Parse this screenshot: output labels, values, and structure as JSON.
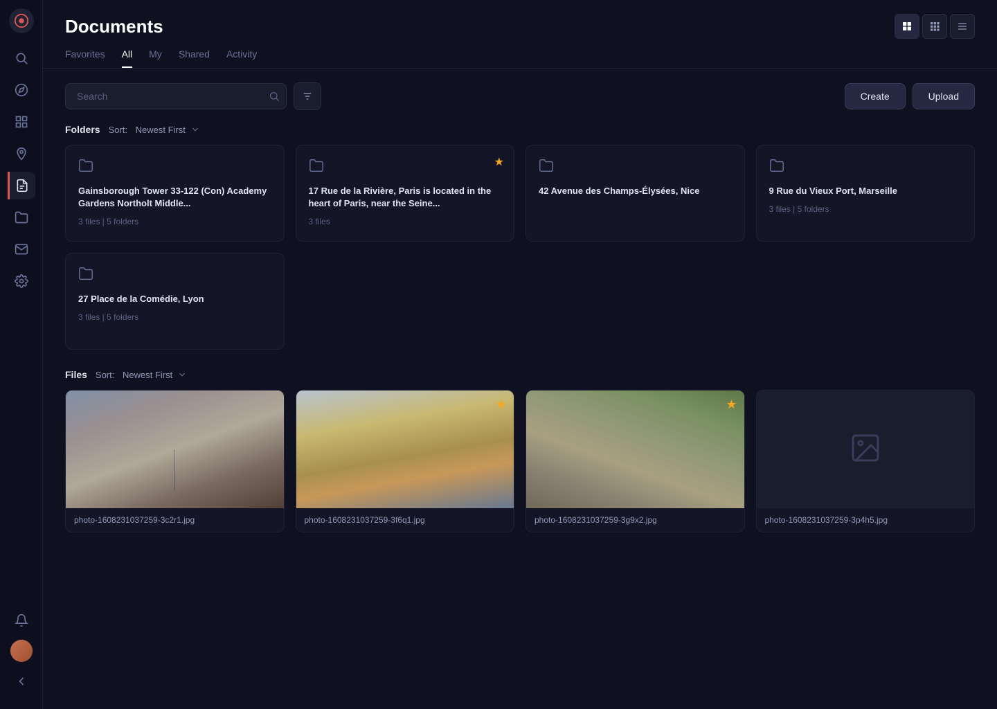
{
  "page": {
    "title": "Documents"
  },
  "sidebar": {
    "items": [
      {
        "id": "search",
        "icon": "search-icon",
        "active": false
      },
      {
        "id": "compass",
        "icon": "compass-icon",
        "active": false
      },
      {
        "id": "grid",
        "icon": "grid-icon",
        "active": false
      },
      {
        "id": "location",
        "icon": "location-icon",
        "active": false
      },
      {
        "id": "documents",
        "icon": "documents-icon",
        "active": true
      },
      {
        "id": "folder",
        "icon": "folder-icon",
        "active": false
      },
      {
        "id": "mail",
        "icon": "mail-icon",
        "active": false
      },
      {
        "id": "settings",
        "icon": "settings-icon",
        "active": false
      }
    ]
  },
  "tabs": [
    {
      "id": "favorites",
      "label": "Favorites",
      "active": false
    },
    {
      "id": "all",
      "label": "All",
      "active": true
    },
    {
      "id": "my",
      "label": "My",
      "active": false
    },
    {
      "id": "shared",
      "label": "Shared",
      "active": false
    },
    {
      "id": "activity",
      "label": "Activity",
      "active": false
    }
  ],
  "search": {
    "placeholder": "Search"
  },
  "buttons": {
    "create": "Create",
    "upload": "Upload"
  },
  "folders_section": {
    "title": "Folders",
    "sort_label": "Sort:",
    "sort_value": "Newest First"
  },
  "files_section": {
    "title": "Files",
    "sort_label": "Sort:",
    "sort_value": "Newest First"
  },
  "folders": [
    {
      "id": 1,
      "name": "Gainsborough Tower 33-122 (Con) Academy Gardens Northolt Middle...",
      "meta": "3 files | 5 folders",
      "starred": false
    },
    {
      "id": 2,
      "name": "17 Rue de la Rivière, Paris is located in the heart of Paris, near the Seine...",
      "meta": "3 files",
      "starred": true
    },
    {
      "id": 3,
      "name": "42 Avenue des Champs-Élysées, Nice",
      "meta": "",
      "starred": false
    },
    {
      "id": 4,
      "name": "9 Rue du Vieux Port, Marseille",
      "meta": "3 files | 5 folders",
      "starred": false
    },
    {
      "id": 5,
      "name": "27 Place de la Comédie, Lyon",
      "meta": "3 files | 5 folders",
      "starred": false
    }
  ],
  "files": [
    {
      "id": 1,
      "name": "photo-1608231037259-3c2r1.jpg",
      "type": "photo-eiffel",
      "starred": false
    },
    {
      "id": 2,
      "name": "photo-1608231037259-3f6q1.jpg",
      "type": "photo-apartment",
      "starred": true
    },
    {
      "id": 3,
      "name": "photo-1608231037259-3g9x2.jpg",
      "type": "photo-aerial",
      "starred": true
    },
    {
      "id": 4,
      "name": "photo-1608231037259-3p4h5.jpg",
      "type": "placeholder",
      "starred": false
    }
  ],
  "view_controls": [
    {
      "id": "grid-large",
      "active": true
    },
    {
      "id": "grid-small",
      "active": false
    },
    {
      "id": "list",
      "active": false
    }
  ]
}
